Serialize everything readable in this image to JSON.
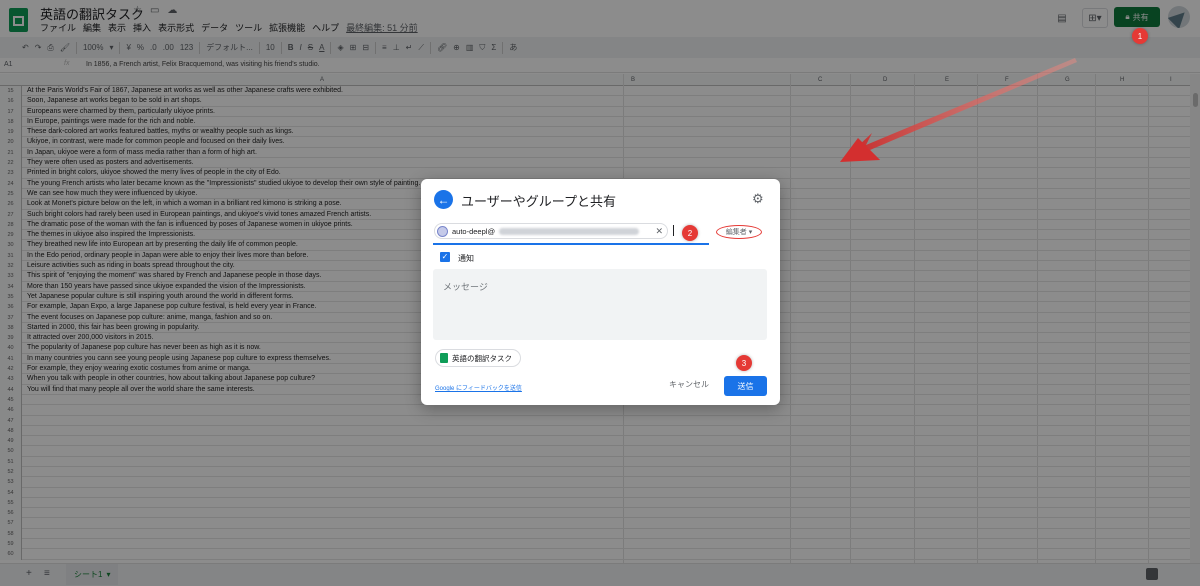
{
  "doc": {
    "title": "英語の翻訳タスク",
    "last_edit": "最終編集: 51 分前",
    "menu": [
      "ファイル",
      "編集",
      "表示",
      "挿入",
      "表示形式",
      "データ",
      "ツール",
      "拡張機能",
      "ヘルプ"
    ]
  },
  "header_buttons": {
    "share_label": "共有",
    "share_icon": "lock-icon"
  },
  "toolbar": {
    "zoom": "100%",
    "currency": "¥",
    "percent": "%",
    "dec_minus": ".0",
    "dec_plus": ".00",
    "format_123": "123",
    "font": "デフォルト...",
    "font_size": "10",
    "bold": "B",
    "italic": "I",
    "strike": "S",
    "text_color": "A"
  },
  "formula_bar": {
    "cell_ref": "A1",
    "fx": "fx",
    "value": "In 1856, a French artist, Felix Bracquemond, was visiting his friend's studio."
  },
  "grid": {
    "columns": [
      "A",
      "B",
      "C",
      "D",
      "E",
      "F",
      "G",
      "H",
      "I"
    ],
    "rows": [
      {
        "num": "15",
        "text": "At the Paris World's Fair of 1867, Japanese art works as well as other Japanese crafts were exhibited."
      },
      {
        "num": "16",
        "text": "Soon, Japanese art works began to be sold in art shops."
      },
      {
        "num": "17",
        "text": "Europeans were charmed by them, particularly ukiyoe prints."
      },
      {
        "num": "18",
        "text": "In Europe, paintings were made for the rich and noble."
      },
      {
        "num": "19",
        "text": "These dark-colored art works featured battles, myths or wealthy people such as kings."
      },
      {
        "num": "20",
        "text": "Ukiyoe, in contrast, were made for common people and focused on their daily lives."
      },
      {
        "num": "21",
        "text": "In Japan, ukiyoe were a form of mass media rather than a form of high art."
      },
      {
        "num": "22",
        "text": "They were often used as posters and advertisements."
      },
      {
        "num": "23",
        "text": "Printed in bright colors, ukiyoe showed the merry lives of people in the city of Edo."
      },
      {
        "num": "24",
        "text": "The young French artists who later became known as the \"Impressionists\" studied  ukiyoe to develop their own style of painting."
      },
      {
        "num": "25",
        "text": "We can see how much they were influenced by ukiyoe."
      },
      {
        "num": "26",
        "text": "Look at Monet's picture below on the left, in which a woman in a brilliant red kimono is striking a pose."
      },
      {
        "num": "27",
        "text": "Such bright colors had rarely been used in European paintings, and ukiyoe's vivid tones amazed French artists."
      },
      {
        "num": "28",
        "text": "The dramatic pose of the woman with the fan is influenced by poses of Japanese women in ukiyoe prints."
      },
      {
        "num": "29",
        "text": "The themes in ukiyoe also inspired the Impressionists."
      },
      {
        "num": "30",
        "text": "They breathed new life into European art by presenting the daily life of common people."
      },
      {
        "num": "31",
        "text": "In the Edo period, ordinary people in Japan were able to enjoy their lives more than before."
      },
      {
        "num": "32",
        "text": "Leisure activities such as riding in boats spread throughout the city."
      },
      {
        "num": "33",
        "text": "This spirit of \"enjoying the moment\" was shared by French and Japanese people in those days."
      },
      {
        "num": "34",
        "text": "More than 150 years have passed since ukiyoe expanded the vision of the Impressionists."
      },
      {
        "num": "35",
        "text": "Yet Japanese popular culture is still inspiring youth around the world in different forms."
      },
      {
        "num": "36",
        "text": "For example, Japan Expo, a large Japanese pop culture festival, is held every year in France."
      },
      {
        "num": "37",
        "text": "The event focuses on Japanese pop culture: anime, manga, fashion and so on."
      },
      {
        "num": "38",
        "text": "Started in 2000, this fair has been growing in popularity."
      },
      {
        "num": "39",
        "text": "It attracted over 200,000 visitors in 2015."
      },
      {
        "num": "40",
        "text": "The popularity of Japanese pop culture has never been as high as it is now."
      },
      {
        "num": "41",
        "text": "In many countries you cann see young people using Japanese pop culture to express themselves."
      },
      {
        "num": "42",
        "text": "For example, they enjoy wearing exotic costumes from anime or manga."
      },
      {
        "num": "43",
        "text": "When you talk with people in other countries, how about talking about Japanese pop culture?"
      },
      {
        "num": "44",
        "text": "You will find that many people all over the world share the same interests."
      },
      {
        "num": "45",
        "text": ""
      },
      {
        "num": "46",
        "text": ""
      },
      {
        "num": "47",
        "text": ""
      },
      {
        "num": "48",
        "text": ""
      },
      {
        "num": "49",
        "text": ""
      },
      {
        "num": "50",
        "text": ""
      },
      {
        "num": "51",
        "text": ""
      },
      {
        "num": "52",
        "text": ""
      },
      {
        "num": "53",
        "text": ""
      },
      {
        "num": "54",
        "text": ""
      },
      {
        "num": "55",
        "text": ""
      },
      {
        "num": "56",
        "text": ""
      },
      {
        "num": "57",
        "text": ""
      },
      {
        "num": "58",
        "text": ""
      },
      {
        "num": "59",
        "text": ""
      },
      {
        "num": "60",
        "text": ""
      }
    ]
  },
  "sheet_bar": {
    "tab_label": "シート1"
  },
  "dialog": {
    "title": "ユーザーやグループと共有",
    "chip_email": "auto-deepl@",
    "role": "編集者",
    "notify_label": "通知",
    "message_placeholder": "メッセージ",
    "file_name": "英語の翻訳タスク",
    "feedback": "Google にフィードバックを送信",
    "cancel": "キャンセル",
    "send": "送信"
  },
  "badges": [
    "1",
    "2",
    "3"
  ],
  "colors": {
    "accent": "#1a73e8",
    "share_green": "#0f7a3d",
    "annotation_red": "#e53935"
  }
}
